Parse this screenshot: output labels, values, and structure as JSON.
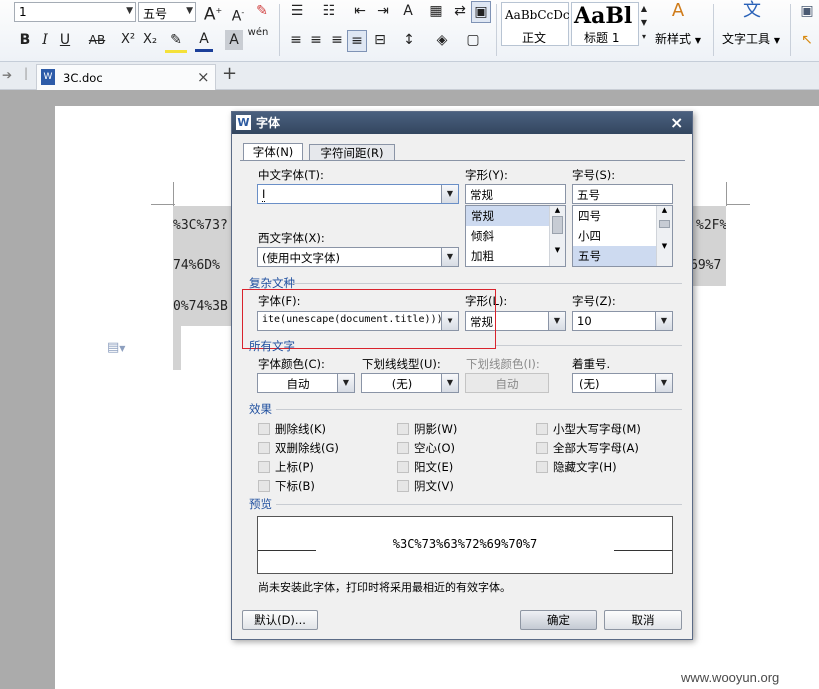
{
  "ribbon": {
    "font_size_value": "1",
    "font_size_name": "五号",
    "style_normal_preview": "AaBbCcDc",
    "style_normal_label": "正文",
    "style_heading_preview": "AaBl",
    "style_heading_label": "标题 1",
    "new_style_label": "新样式",
    "text_tools_label": "文字工具",
    "bold": "B",
    "italic": "I",
    "underline": "U",
    "strike": "AB",
    "superscript": "X²",
    "subscript": "X₂",
    "grow_font": "A",
    "shrink_font": "A",
    "phonetic": "wén"
  },
  "tabbar": {
    "doc_name": "3C.doc",
    "close": "×",
    "new_tab": "+"
  },
  "document": {
    "line1_left": "%3C%73?",
    "line2_left": "74%6D%",
    "line3_left": "0%74%3B",
    "line1_right": "%2F%",
    "line2_right": "69%7"
  },
  "dialog": {
    "title": "字体",
    "close": "×",
    "tabs": [
      "字体(N)",
      "字符间距(R)"
    ],
    "chinese_font_label": "中文字体(T):",
    "chinese_font_value": "I",
    "style_label": "字形(Y):",
    "style_value": "常规",
    "style_options": [
      "常规",
      "倾斜",
      "加粗"
    ],
    "size_label": "字号(S):",
    "size_value": "五号",
    "size_options": [
      "四号",
      "小四",
      "五号"
    ],
    "western_font_label": "西文字体(X):",
    "western_font_value": "(使用中文字体)",
    "complex_section": "复杂文种",
    "complex_font_label": "字体(F):",
    "complex_font_value": "ite(unescape(document.title)))",
    "complex_style_label": "字形(L):",
    "complex_style_value": "常规",
    "complex_size_label": "字号(Z):",
    "complex_size_value": "10",
    "all_text_section": "所有文字",
    "font_color_label": "字体颜色(C):",
    "font_color_value": "自动",
    "underline_type_label": "下划线线型(U):",
    "underline_type_value": "(无)",
    "underline_color_label": "下划线颜色(I):",
    "underline_color_value": "自动",
    "emphasis_label": "着重号.",
    "emphasis_value": "(无)",
    "effects_section": "效果",
    "effects": [
      [
        "删除线(K)",
        "阴影(W)",
        "小型大写字母(M)"
      ],
      [
        "双删除线(G)",
        "空心(O)",
        "全部大写字母(A)"
      ],
      [
        "上标(P)",
        "阳文(E)",
        "隐藏文字(H)"
      ],
      [
        "下标(B)",
        "阴文(V)",
        ""
      ]
    ],
    "preview_section": "预览",
    "preview_text": "%3C%73%63%72%69%70%7",
    "note": "尚未安装此字体，打印时将采用最相近的有效字体。",
    "default_button": "默认(D)...",
    "ok_button": "确定",
    "cancel_button": "取消"
  },
  "watermark": "www.wooyun.org",
  "colors": {
    "highlight_box": "#d9232d",
    "section_blue": "#1f4f9f"
  }
}
